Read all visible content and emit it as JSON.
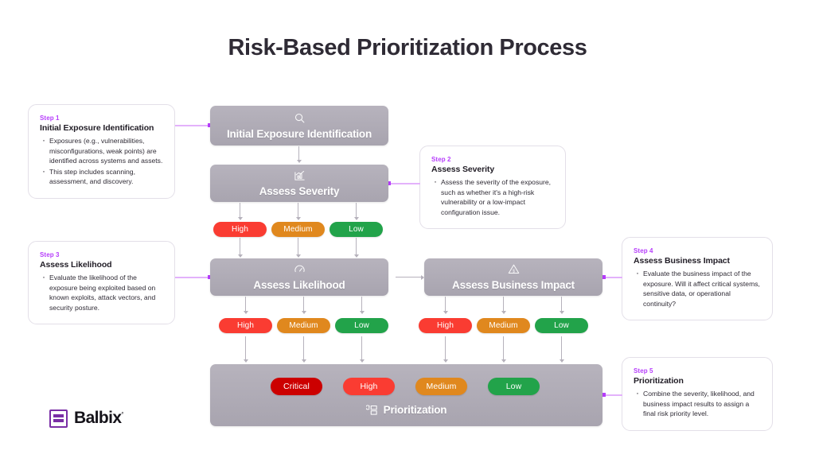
{
  "page": {
    "title": "Risk-Based Prioritization Process",
    "background": "#ffffff",
    "accent": "#b63dfb"
  },
  "logo": {
    "name": "Balbix",
    "trademark": "°",
    "color": "#7a2ea6"
  },
  "flow": {
    "nodes": [
      {
        "id": "initial-exposure-identification",
        "label": "Initial Exposure Identification",
        "icon": "search-icon"
      },
      {
        "id": "assess-severity",
        "label": "Assess Severity",
        "icon": "bar-chart-icon"
      },
      {
        "id": "assess-likelihood",
        "label": "Assess Likelihood",
        "icon": "gauge-icon"
      },
      {
        "id": "assess-business-impact",
        "label": "Assess Business Impact",
        "icon": "warning-dollar-icon"
      },
      {
        "id": "prioritization",
        "label": "Prioritization",
        "icon": "priority-list-icon"
      }
    ]
  },
  "severity_colors": {
    "critical": "#cc0000",
    "high": "#fa3c32",
    "medium": "#e0881e",
    "low": "#22a34a"
  },
  "pill_rows": {
    "severity": [
      {
        "label": "High",
        "level": "high"
      },
      {
        "label": "Medium",
        "level": "medium"
      },
      {
        "label": "Low",
        "level": "low"
      }
    ],
    "likelihood": [
      {
        "label": "High",
        "level": "high"
      },
      {
        "label": "Medium",
        "level": "medium"
      },
      {
        "label": "Low",
        "level": "low"
      }
    ],
    "business_impact": [
      {
        "label": "High",
        "level": "high"
      },
      {
        "label": "Medium",
        "level": "medium"
      },
      {
        "label": "Low",
        "level": "low"
      }
    ],
    "priority_result": [
      {
        "label": "Critical",
        "level": "critical"
      },
      {
        "label": "High",
        "level": "high"
      },
      {
        "label": "Medium",
        "level": "medium"
      },
      {
        "label": "Low",
        "level": "low"
      }
    ]
  },
  "callouts": [
    {
      "step": "Step 1",
      "title": "Initial Exposure Identification",
      "bullets": [
        "Exposures (e.g., vulnerabilities, misconfigurations, weak points) are identified across systems and assets.",
        "This step includes scanning, assessment, and discovery."
      ]
    },
    {
      "step": "Step 2",
      "title": "Assess Severity",
      "bullets": [
        "Assess the severity of the exposure, such as whether it's a high-risk vulnerability or a low-impact configuration issue."
      ]
    },
    {
      "step": "Step 3",
      "title": "Assess Likelihood",
      "bullets": [
        "Evaluate the likelihood of the exposure being exploited based on known exploits, attack vectors, and security posture."
      ]
    },
    {
      "step": "Step 4",
      "title": "Assess Business Impact",
      "bullets": [
        "Evaluate the business impact of the exposure. Will it affect critical systems, sensitive data, or operational continuity?"
      ]
    },
    {
      "step": "Step 5",
      "title": "Prioritization",
      "bullets": [
        "Combine the severity, likelihood, and business impact results to assign a final risk priority level."
      ]
    }
  ]
}
